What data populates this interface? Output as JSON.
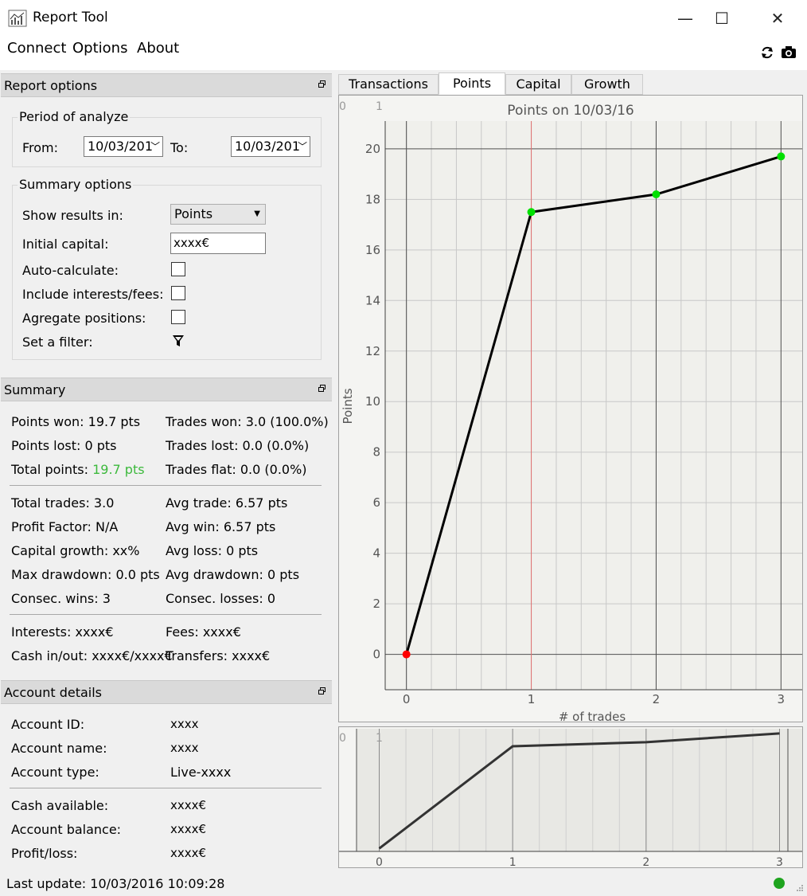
{
  "window": {
    "title": "Report Tool",
    "minimize": "—",
    "maximize": "☐",
    "close": "✕"
  },
  "menu": [
    "Connect",
    "Options",
    "About"
  ],
  "toolbar": {
    "refresh_icon": "refresh-icon",
    "camera_icon": "camera-icon"
  },
  "report_options": {
    "header": "Report options",
    "period_group": "Period of analyze",
    "from_label": "From:",
    "from_value": "10/03/201",
    "to_label": "To:",
    "to_value": "10/03/201",
    "summary_group": "Summary options",
    "show_results_label": "Show results in:",
    "show_results_value": "Points",
    "initial_capital_label": "Initial capital:",
    "initial_capital_value": "xxxx€",
    "auto_calculate_label": "Auto-calculate:",
    "include_interests_label": "Include interests/fees:",
    "aggregate_label": "Agregate positions:",
    "filter_label": "Set a filter:",
    "filter_icon": "filter-icon"
  },
  "summary": {
    "header": "Summary",
    "points_won": "Points won: 19.7 pts",
    "trades_won": "Trades won: 3.0 (100.0%)",
    "points_lost": "Points lost: 0 pts",
    "trades_lost": "Trades lost: 0.0 (0.0%)",
    "total_points_label": "Total points: ",
    "total_points_value": "19.7 pts",
    "total_points_color": "#3cb93c",
    "trades_flat": "Trades flat: 0.0 (0.0%)",
    "total_trades": "Total trades: 3.0",
    "avg_trade": "Avg trade: 6.57 pts",
    "profit_factor": "Profit Factor: N/A",
    "avg_win": "Avg win: 6.57 pts",
    "capital_growth": "Capital growth: xx%",
    "avg_loss": "Avg loss: 0 pts",
    "max_drawdown": "Max drawdown: 0.0 pts",
    "avg_drawdown": "Avg drawdown: 0 pts",
    "consec_wins": "Consec. wins: 3",
    "consec_losses": "Consec. losses: 0",
    "interests": "Interests: xxxx€",
    "fees": "Fees: xxxx€",
    "cash_inout": "Cash in/out: xxxx€/xxxx€",
    "transfers": "Transfers: xxxx€"
  },
  "account": {
    "header": "Account details",
    "rows": [
      {
        "label": "Account ID:",
        "value": "xxxx"
      },
      {
        "label": "Account name:",
        "value": "xxxx"
      },
      {
        "label": "Account type:",
        "value": "Live-xxxx"
      },
      {
        "label": "Cash available:",
        "value": "xxxx€"
      },
      {
        "label": "Account balance:",
        "value": "xxxx€"
      },
      {
        "label": "Profit/loss:",
        "value": "xxxx€"
      }
    ]
  },
  "status": {
    "text": "Last update: 10/03/2016 10:09:28",
    "indicator_color": "#1ea41e"
  },
  "tabs": [
    "Transactions",
    "Points",
    "Capital",
    "Growth"
  ],
  "active_tab": "Points",
  "chart_data": {
    "type": "line",
    "title": "Points on 10/03/16",
    "xlabel": "# of trades",
    "ylabel": "Points",
    "x": [
      0,
      1,
      2,
      3
    ],
    "y": [
      0,
      17.5,
      18.2,
      19.7
    ],
    "point_colors": [
      "#ff0000",
      "#00e000",
      "#00e000",
      "#00e000"
    ],
    "xlim": [
      -0.17,
      3.17
    ],
    "ylim": [
      -1.4,
      21.1
    ],
    "xticks": [
      "0",
      "1",
      "2",
      "3"
    ],
    "yticks": [
      "0",
      "2",
      "4",
      "6",
      "8",
      "10",
      "12",
      "14",
      "16",
      "18",
      "20"
    ],
    "grid": true,
    "cursor_x": 1,
    "cursor_color": "#e07070",
    "corner_labels": [
      "0",
      "1"
    ]
  },
  "overview_data": {
    "type": "line",
    "x": [
      0,
      1,
      2,
      3
    ],
    "y": [
      0,
      17.5,
      18.2,
      19.7
    ],
    "xticks": [
      "0",
      "1",
      "2",
      "3"
    ],
    "corner_labels": [
      "0",
      "1"
    ]
  }
}
